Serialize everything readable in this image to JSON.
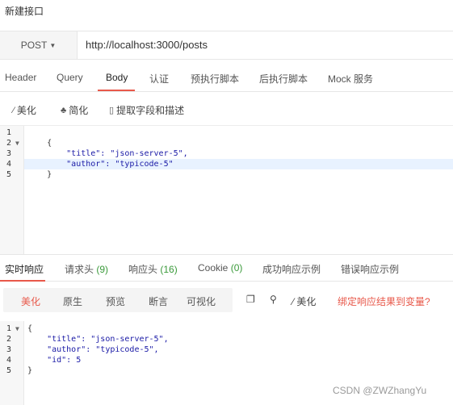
{
  "page_title": "新建接口",
  "request": {
    "method": "POST",
    "url": "http://localhost:3000/posts"
  },
  "request_tabs": [
    {
      "label": "Header"
    },
    {
      "label": "Query"
    },
    {
      "label": "Body"
    },
    {
      "label": "认证"
    },
    {
      "label": "预执行脚本"
    },
    {
      "label": "后执行脚本"
    },
    {
      "label": "Mock 服务"
    }
  ],
  "body_toolbar": {
    "beautify": "美化",
    "simplify": "简化",
    "extract": "提取字段和描述"
  },
  "request_body": {
    "line_numbers": [
      "1",
      "2",
      "3",
      "4",
      "5"
    ],
    "lines": [
      "",
      "    {",
      "        \"title\": \"json-server-5\",",
      "        \"author\": \"typicode-5\"",
      "    }"
    ]
  },
  "response_tabs": [
    {
      "label": "实时响应",
      "count": ""
    },
    {
      "label": "请求头",
      "count": "(9)"
    },
    {
      "label": "响应头",
      "count": "(16)"
    },
    {
      "label": "Cookie",
      "count": "(0)"
    },
    {
      "label": "成功响应示例",
      "count": ""
    },
    {
      "label": "错误响应示例",
      "count": ""
    }
  ],
  "response_toolbar": {
    "views": [
      "美化",
      "原生",
      "预览",
      "断言",
      "可视化"
    ],
    "beautify": "美化",
    "bind_result": "绑定响应结果到变量?"
  },
  "response_body": {
    "line_numbers": [
      "1",
      "2",
      "3",
      "4",
      "5"
    ],
    "lines": [
      "{",
      "    \"title\": \"json-server-5\",",
      "    \"author\": \"typicode-5\",",
      "    \"id\": 5",
      "}"
    ]
  },
  "watermark": "CSDN @ZWZhangYu"
}
